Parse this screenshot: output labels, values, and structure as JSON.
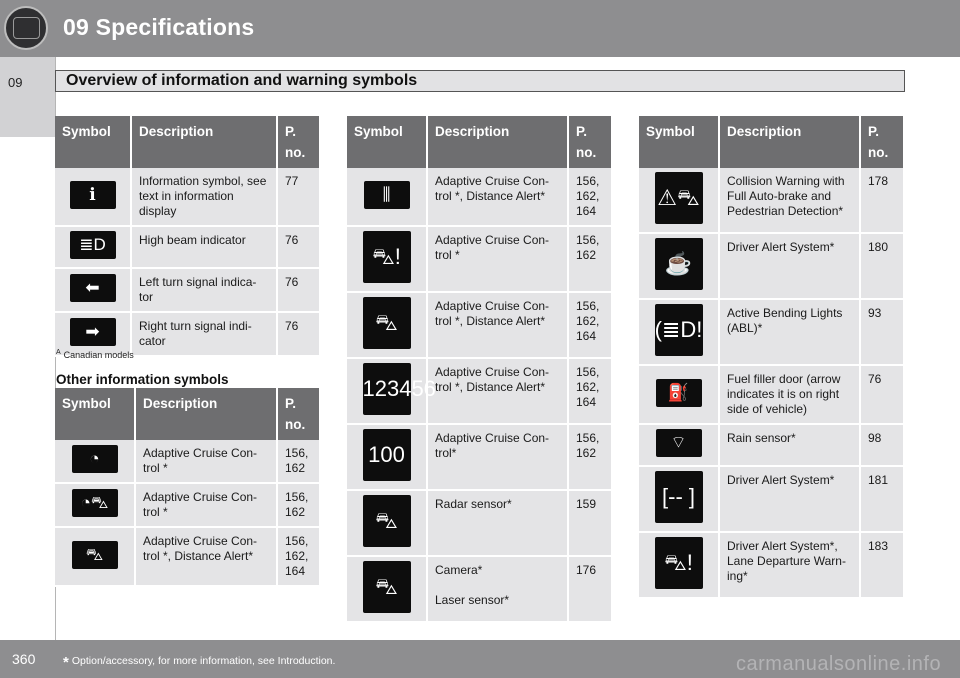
{
  "header": {
    "chapter_title": "09  Specifications"
  },
  "side_tab": {
    "label": "09"
  },
  "section": {
    "title": "Overview of information and warning symbols"
  },
  "columns": {
    "symbol": "Symbol",
    "description": "Description",
    "page": "P.\nno."
  },
  "table_top_left": [
    {
      "icon": "information-icon",
      "glyph": "ℹ",
      "description": "Information symbol, see text in information display",
      "page": "77"
    },
    {
      "icon": "high-beam-icon",
      "glyph": "≣D",
      "description": "High beam indicator",
      "page": "76"
    },
    {
      "icon": "left-turn-signal-icon",
      "glyph": "⬅",
      "description": "Left turn signal indica-tor",
      "page": "76"
    },
    {
      "icon": "right-turn-signal-icon",
      "glyph": "➡",
      "description": "Right turn signal indi-cator",
      "page": "76"
    }
  ],
  "footnote": {
    "marker": "A",
    "text": "Canadian models"
  },
  "other_title": "Other information symbols",
  "table_bottom_left": [
    {
      "icon": "speedometer-icon",
      "glyph": "◔",
      "description": "Adaptive Cruise Con-trol *",
      "page": "156,\n162"
    },
    {
      "icon": "speedometer-car-icon",
      "glyph": "◔⛍",
      "description": "Adaptive Cruise Con-trol *",
      "page": "156,\n162"
    },
    {
      "icon": "car-distance-icon",
      "glyph": "⛍",
      "description": "Adaptive Cruise Con-trol *, Distance Alert*",
      "page": "156,\n162,\n164"
    }
  ],
  "table_middle": [
    {
      "icon": "distance-bars-icon",
      "glyph": "⫼",
      "size": "small",
      "description": "Adaptive Cruise Con-trol *, Distance Alert*",
      "page": "156,\n162,\n164"
    },
    {
      "icon": "car-warning-icon",
      "glyph": "⛍!",
      "size": "big",
      "description": "Adaptive Cruise Con-trol *",
      "page": "156,\n162"
    },
    {
      "icon": "car-road-icon",
      "glyph": "⛍",
      "size": "big",
      "description": "Adaptive Cruise Con-trol *, Distance Alert*",
      "page": "156,\n162,\n164"
    },
    {
      "icon": "speed-gauge-icon",
      "glyph": "123456",
      "size": "big",
      "description": "Adaptive Cruise Con-trol *, Distance Alert*",
      "page": "156,\n162,\n164"
    },
    {
      "icon": "trip-gauge-icon",
      "glyph": "100",
      "size": "big",
      "description": "Adaptive Cruise Con-trol*",
      "page": "156,\n162"
    },
    {
      "icon": "radar-sensor-icon",
      "glyph": "⛍",
      "size": "big",
      "description": "Radar sensor*",
      "page": "159"
    },
    {
      "icon": "camera-icon",
      "glyph": "⛍",
      "size": "big",
      "description": "Camera*\n\nLaser sensor*",
      "page": "176"
    }
  ],
  "table_right": [
    {
      "icon": "collision-warning-icon",
      "glyph": "⚠⛍",
      "size": "big",
      "description": "Collision Warning with Full Auto-brake and Pedestrian Detection*",
      "page": "178"
    },
    {
      "icon": "coffee-cup-icon",
      "glyph": "☕",
      "size": "big",
      "description": "Driver Alert System*",
      "page": "180"
    },
    {
      "icon": "bending-lights-icon",
      "glyph": "(≣D!",
      "size": "big",
      "description": "Active Bending Lights (ABL)*",
      "page": "93"
    },
    {
      "icon": "fuel-door-icon",
      "glyph": "⛽",
      "size": "small",
      "description": "Fuel filler door (arrow indicates it is on right side of vehicle)",
      "page": "76"
    },
    {
      "icon": "rain-sensor-icon",
      "glyph": "⌔",
      "size": "small",
      "description": "Rain sensor*",
      "page": "98"
    },
    {
      "icon": "lane-bracket-icon",
      "glyph": "[-- ]",
      "size": "big",
      "description": "Driver Alert System*",
      "page": "181"
    },
    {
      "icon": "lane-departure-icon",
      "glyph": "⛍!",
      "size": "big",
      "description": "Driver Alert System*, Lane Departure Warn-ing*",
      "page": "183"
    }
  ],
  "footer": {
    "page_number": "360",
    "asterisk": "*",
    "note": "Option/accessory, for more information, see Introduction."
  },
  "watermark": "carmanualsonline.info"
}
